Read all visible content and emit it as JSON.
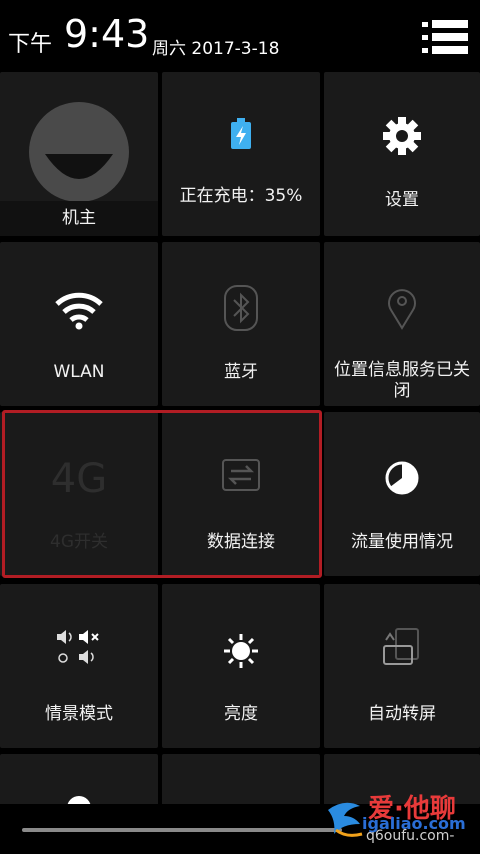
{
  "status_bar": {
    "ampm": "下午",
    "time": "9:43",
    "date": "周六 2017-3-18"
  },
  "tiles": {
    "owner": {
      "label": "机主"
    },
    "charging": {
      "label": "正在充电：35%"
    },
    "settings": {
      "label": "设置"
    },
    "wlan": {
      "label": "WLAN"
    },
    "bluetooth": {
      "label": "蓝牙"
    },
    "location": {
      "label": "位置信息服务已关闭"
    },
    "lte": {
      "label": "4G开关",
      "icon_text": "4G"
    },
    "data": {
      "label": "数据连接"
    },
    "traffic": {
      "label": "流量使用情况"
    },
    "scene": {
      "label": "情景模式"
    },
    "brightness": {
      "label": "亮度"
    },
    "rotate": {
      "label": "自动转屏"
    }
  },
  "watermark": {
    "line1": "爱·他聊",
    "line2": "igaliao.com",
    "line3": "q6oufu.com-"
  },
  "colors": {
    "highlight": "#b21d24",
    "tile": "#1a1a1a",
    "charging_icon": "#3fb0f0"
  }
}
